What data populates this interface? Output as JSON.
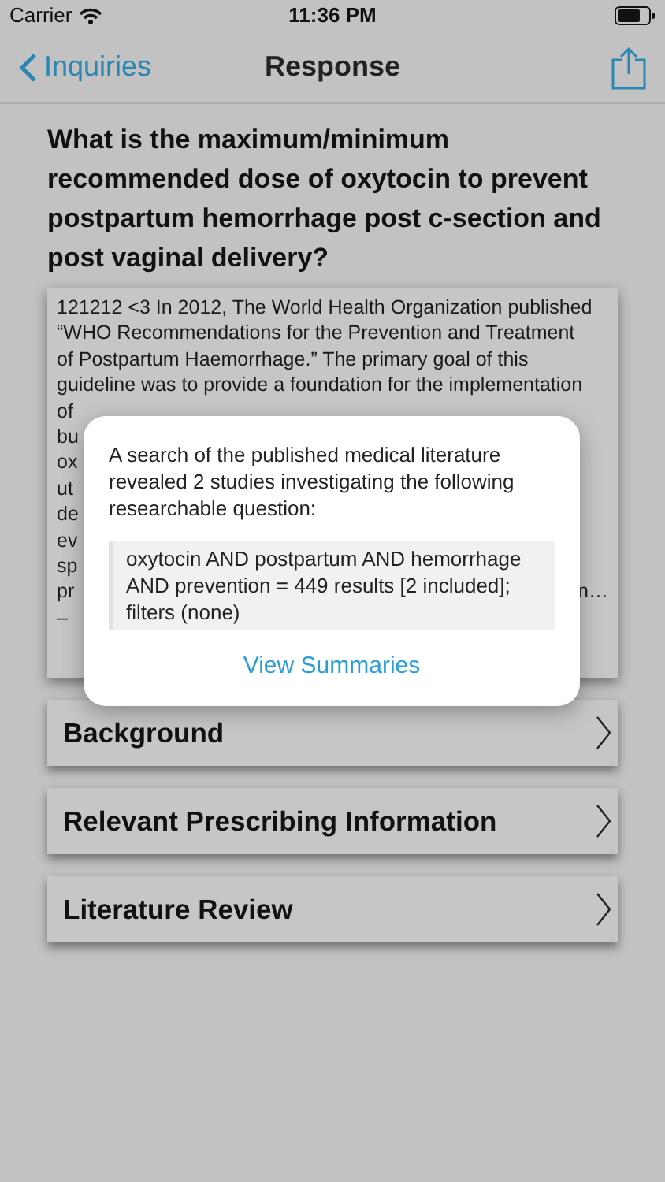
{
  "status_bar": {
    "carrier": "Carrier",
    "time": "11:36 PM"
  },
  "nav": {
    "back": "Inquiries",
    "title": "Response"
  },
  "question": "What is the maximum/minimum recommended dose of oxytocin to prevent postpartum hemorrhage post c-section and post vaginal delivery?",
  "answer_card": {
    "lines": [
      "121212 <3 In 2012, The World Health Organization published",
      "“WHO Recommendations for the Prevention and Treatment",
      "of Postpartum Haemorrhage.” The primary goal of this",
      "guideline was to provide a foundation for the implementation"
    ],
    "cut_lines": [
      {
        "left": "of"
      },
      {
        "left": "bu"
      },
      {
        "left": "ox"
      },
      {
        "left": "ut"
      },
      {
        "left": "de"
      },
      {
        "left": "ev"
      },
      {
        "left": "sp"
      },
      {
        "left": "pr",
        "right": "n…"
      },
      {
        "left": "–"
      }
    ]
  },
  "dialog": {
    "message": "A search of the published medical literature revealed 2 studies investigating the following researchable question:",
    "query": "oxytocin AND postpartum AND hemorrhage AND prevention = 449 results [2 included]; filters (none)",
    "action": "View Summaries"
  },
  "sections": [
    {
      "label": "Background"
    },
    {
      "label": "Relevant Prescribing Information"
    },
    {
      "label": "Literature Review"
    }
  ]
}
